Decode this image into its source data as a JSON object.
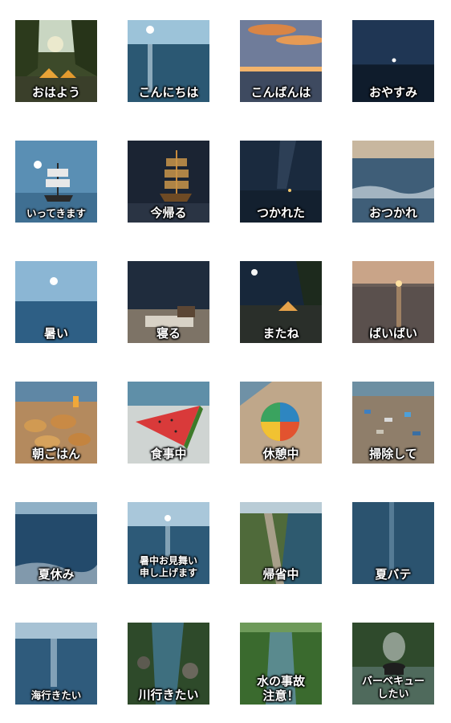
{
  "stickers": [
    {
      "label": "おはよう",
      "scene": "forest-camp-sunrise"
    },
    {
      "label": "こんにちは",
      "scene": "ocean-day-sun"
    },
    {
      "label": "こんばんは",
      "scene": "sunset-clouds"
    },
    {
      "label": "おやすみ",
      "scene": "night-sea-star"
    },
    {
      "label": "いってきます",
      "scene": "sailing-ship-day"
    },
    {
      "label": "今帰る",
      "scene": "sailing-ship-night"
    },
    {
      "label": "つかれた",
      "scene": "milky-way-sea"
    },
    {
      "label": "おつかれ",
      "scene": "evening-waves"
    },
    {
      "label": "暑い",
      "scene": "ocean-sun-high"
    },
    {
      "label": "寝る",
      "scene": "bed-on-beach"
    },
    {
      "label": "またね",
      "scene": "night-tent-lake"
    },
    {
      "label": "ばいばい",
      "scene": "sunset-sea"
    },
    {
      "label": "朝ごはん",
      "scene": "breakfast-beach"
    },
    {
      "label": "食事中",
      "scene": "watermelon-beach"
    },
    {
      "label": "休憩中",
      "scene": "umbrella-sand"
    },
    {
      "label": "掃除して",
      "scene": "trash-beach"
    },
    {
      "label": "夏休み",
      "scene": "deep-blue-sea"
    },
    {
      "label": "暑中お見舞い申し上げます",
      "scene": "sea-sun-sparkle"
    },
    {
      "label": "帰省中",
      "scene": "coastal-road"
    },
    {
      "label": "夏バテ",
      "scene": "calm-sea"
    },
    {
      "label": "海行きたい",
      "scene": "sea-sun-glitter"
    },
    {
      "label": "川行きたい",
      "scene": "forest-stream"
    },
    {
      "label": "水の事故注意！",
      "scene": "green-river"
    },
    {
      "label": "バーベキューしたい",
      "scene": "bbq-grill"
    }
  ]
}
